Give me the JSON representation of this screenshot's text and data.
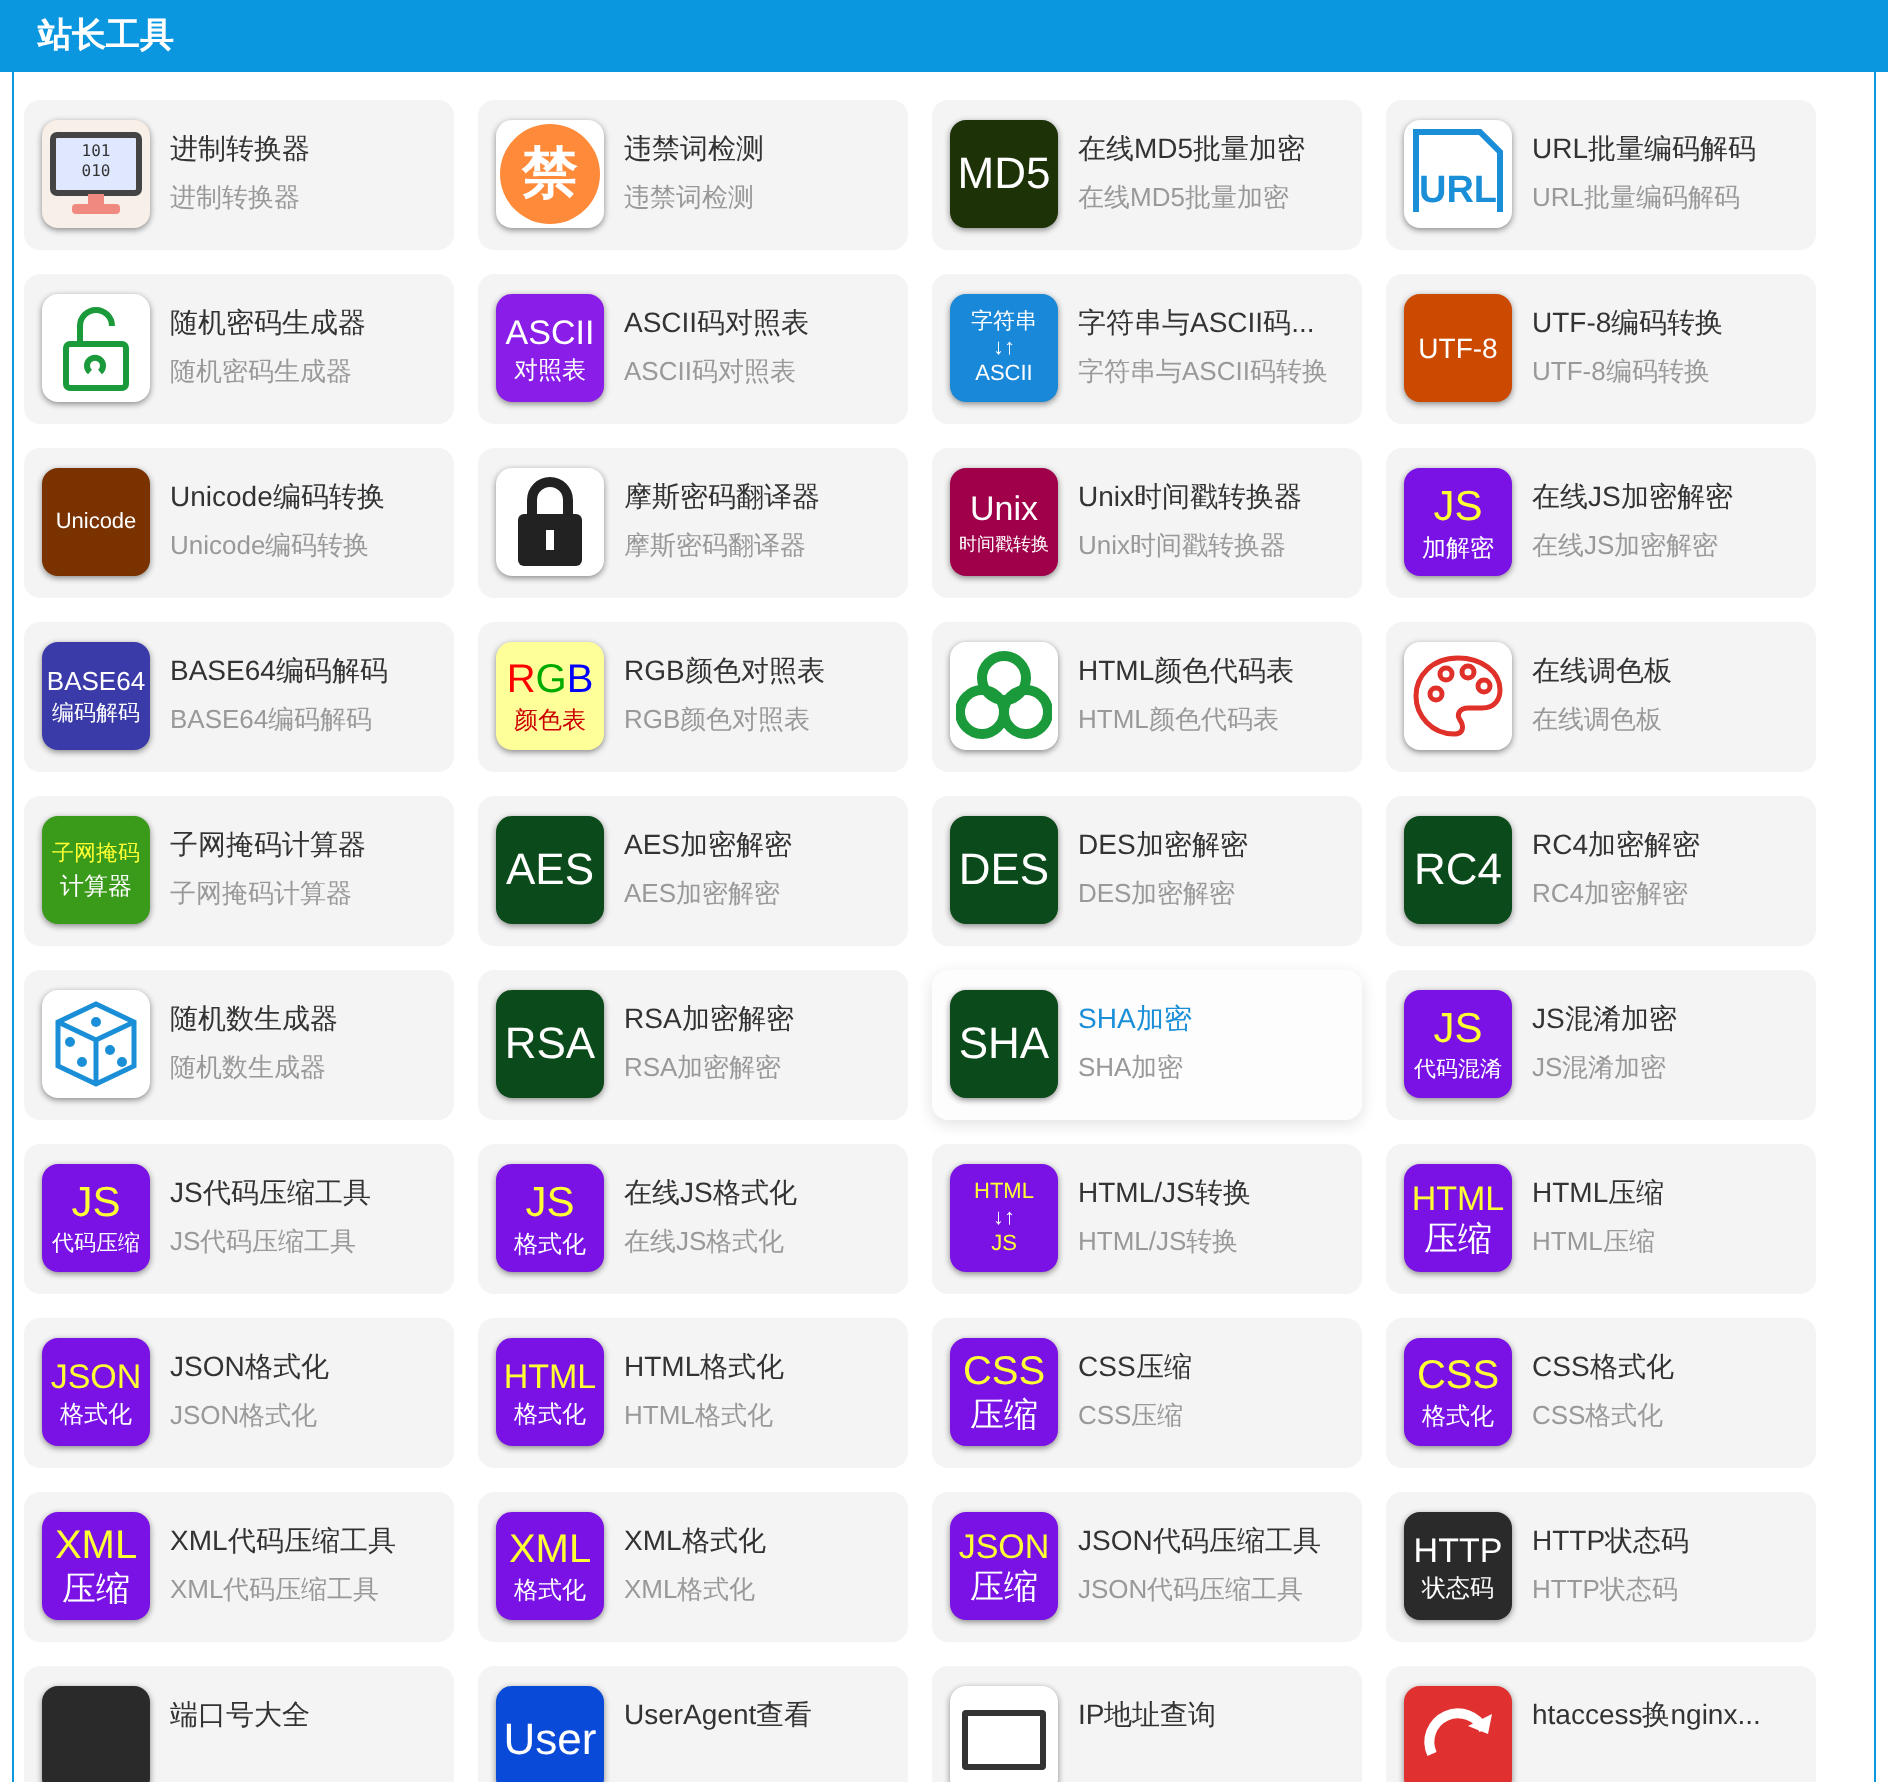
{
  "header": {
    "title": "站长工具"
  },
  "tools": [
    {
      "title": "进制转换器",
      "subtitle": "进制转换器",
      "hovered": false,
      "icon": {
        "kind": "monitor",
        "lines": [
          {
            "parts": [
              {
                "text": "101",
                "color": "#333333"
              }
            ]
          },
          {
            "parts": [
              {
                "text": "010",
                "color": "#333333"
              }
            ]
          }
        ]
      }
    },
    {
      "title": "违禁词检测",
      "subtitle": "违禁词检测",
      "hovered": false,
      "icon": {
        "kind": "circle",
        "color": "#ff8a3a",
        "lines": [
          {
            "parts": [
              {
                "text": "禁",
                "color": "#ffffff"
              }
            ]
          }
        ]
      }
    },
    {
      "title": "在线MD5批量加密",
      "subtitle": "在线MD5批量加密",
      "hovered": false,
      "icon": {
        "kind": "text",
        "color": "#1d3206",
        "lines": [
          {
            "parts": [
              {
                "text": "MD5",
                "color": "#ffffff"
              }
            ]
          }
        ]
      }
    },
    {
      "title": "URL批量编码解码",
      "subtitle": "URL批量编码解码",
      "hovered": false,
      "icon": {
        "kind": "document",
        "lines": [
          {
            "parts": [
              {
                "text": "URL",
                "color": "#1a8fd8"
              }
            ]
          }
        ]
      }
    },
    {
      "title": "随机密码生成器",
      "subtitle": "随机密码生成器",
      "hovered": false,
      "icon": {
        "kind": "open-lock"
      }
    },
    {
      "title": "ASCII码对照表",
      "subtitle": "ASCII码对照表",
      "hovered": false,
      "icon": {
        "kind": "text",
        "color": "#8a1ee8",
        "lines": [
          {
            "parts": [
              {
                "text": "ASCII",
                "color": "#ffffff"
              }
            ]
          },
          {
            "parts": [
              {
                "text": "对照表",
                "color": "#ffffff"
              }
            ]
          }
        ]
      }
    },
    {
      "title": "字符串与ASCII码...",
      "subtitle": "字符串与ASCII码转换",
      "hovered": false,
      "icon": {
        "kind": "text",
        "color": "#1a88d8",
        "lines": [
          {
            "parts": [
              {
                "text": "字符串",
                "color": "#ffffff"
              }
            ]
          },
          {
            "parts": [
              {
                "text": "↓↑",
                "color": "#ffffff"
              }
            ]
          },
          {
            "parts": [
              {
                "text": "ASCII",
                "color": "#ffffff"
              }
            ]
          }
        ]
      }
    },
    {
      "title": "UTF-8编码转换",
      "subtitle": "UTF-8编码转换",
      "hovered": false,
      "icon": {
        "kind": "text",
        "color": "#cc4a00",
        "lines": [
          {
            "parts": [
              {
                "text": "UTF-8",
                "color": "#ffffff"
              }
            ]
          }
        ]
      }
    },
    {
      "title": "Unicode编码转换",
      "subtitle": "Unicode编码转换",
      "hovered": false,
      "icon": {
        "kind": "text",
        "color": "#7a3200",
        "lines": [
          {
            "parts": [
              {
                "text": "Unicode",
                "color": "#ffffff"
              }
            ]
          }
        ]
      }
    },
    {
      "title": "摩斯密码翻译器",
      "subtitle": "摩斯密码翻译器",
      "hovered": false,
      "icon": {
        "kind": "padlock"
      }
    },
    {
      "title": "Unix时间戳转换器",
      "subtitle": "Unix时间戳转换器",
      "hovered": false,
      "icon": {
        "kind": "text",
        "color": "#a0004a",
        "lines": [
          {
            "parts": [
              {
                "text": "Unix",
                "color": "#ffffff"
              }
            ]
          },
          {
            "parts": [
              {
                "text": "时间戳转换",
                "color": "#ffffff"
              }
            ]
          }
        ]
      }
    },
    {
      "title": "在线JS加密解密",
      "subtitle": "在线JS加密解密",
      "hovered": false,
      "icon": {
        "kind": "text",
        "color": "#7a12e6",
        "lines": [
          {
            "parts": [
              {
                "text": "JS",
                "color": "#ffff33"
              }
            ]
          },
          {
            "parts": [
              {
                "text": "加解密",
                "color": "#ffffff"
              }
            ]
          }
        ]
      }
    },
    {
      "title": "BASE64编码解码",
      "subtitle": "BASE64编码解码",
      "hovered": false,
      "icon": {
        "kind": "text",
        "color": "#3a3aa8",
        "lines": [
          {
            "parts": [
              {
                "text": "BASE64",
                "color": "#ffffff"
              }
            ]
          },
          {
            "parts": [
              {
                "text": "编码解码",
                "color": "#ffffff"
              }
            ]
          }
        ]
      }
    },
    {
      "title": "RGB颜色对照表",
      "subtitle": "RGB颜色对照表",
      "hovered": false,
      "icon": {
        "kind": "text",
        "color": "#ffff99",
        "lines": [
          {
            "parts": [
              {
                "text": "R",
                "color": "#ff0000"
              },
              {
                "text": "G",
                "color": "#00aa00"
              },
              {
                "text": "B",
                "color": "#0000ff"
              }
            ]
          },
          {
            "parts": [
              {
                "text": "颜色表",
                "color": "#cc0000"
              }
            ]
          }
        ]
      }
    },
    {
      "title": "HTML颜色代码表",
      "subtitle": "HTML颜色代码表",
      "hovered": false,
      "icon": {
        "kind": "rings"
      }
    },
    {
      "title": "在线调色板",
      "subtitle": "在线调色板",
      "hovered": false,
      "icon": {
        "kind": "palette"
      }
    },
    {
      "title": "子网掩码计算器",
      "subtitle": "子网掩码计算器",
      "hovered": false,
      "icon": {
        "kind": "text",
        "color": "#3a9a1a",
        "lines": [
          {
            "parts": [
              {
                "text": "子网掩码",
                "color": "#ffff33"
              }
            ]
          },
          {
            "parts": [
              {
                "text": "计算器",
                "color": "#ffffff"
              }
            ]
          }
        ]
      }
    },
    {
      "title": "AES加密解密",
      "subtitle": "AES加密解密",
      "hovered": false,
      "icon": {
        "kind": "text",
        "color": "#0b4a1a",
        "lines": [
          {
            "parts": [
              {
                "text": "AES",
                "color": "#ffffff"
              }
            ]
          }
        ]
      }
    },
    {
      "title": "DES加密解密",
      "subtitle": "DES加密解密",
      "hovered": false,
      "icon": {
        "kind": "text",
        "color": "#0b4a1a",
        "lines": [
          {
            "parts": [
              {
                "text": "DES",
                "color": "#ffffff"
              }
            ]
          }
        ]
      }
    },
    {
      "title": "RC4加密解密",
      "subtitle": "RC4加密解密",
      "hovered": false,
      "icon": {
        "kind": "text",
        "color": "#0b4a1a",
        "lines": [
          {
            "parts": [
              {
                "text": "RC4",
                "color": "#ffffff"
              }
            ]
          }
        ]
      }
    },
    {
      "title": "随机数生成器",
      "subtitle": "随机数生成器",
      "hovered": false,
      "icon": {
        "kind": "dice"
      }
    },
    {
      "title": "RSA加密解密",
      "subtitle": "RSA加密解密",
      "hovered": false,
      "icon": {
        "kind": "text",
        "color": "#0b4a1a",
        "lines": [
          {
            "parts": [
              {
                "text": "RSA",
                "color": "#ffffff"
              }
            ]
          }
        ]
      }
    },
    {
      "title": "SHA加密",
      "subtitle": "SHA加密",
      "hovered": true,
      "icon": {
        "kind": "text",
        "color": "#0b4a1a",
        "lines": [
          {
            "parts": [
              {
                "text": "SHA",
                "color": "#ffffff"
              }
            ]
          }
        ]
      }
    },
    {
      "title": "JS混淆加密",
      "subtitle": "JS混淆加密",
      "hovered": false,
      "icon": {
        "kind": "text",
        "color": "#7a12e6",
        "lines": [
          {
            "parts": [
              {
                "text": "JS",
                "color": "#ffff33"
              }
            ]
          },
          {
            "parts": [
              {
                "text": "代码混淆",
                "color": "#ffffff"
              }
            ]
          }
        ]
      }
    },
    {
      "title": "JS代码压缩工具",
      "subtitle": "JS代码压缩工具",
      "hovered": false,
      "icon": {
        "kind": "text",
        "color": "#7a12e6",
        "lines": [
          {
            "parts": [
              {
                "text": "JS",
                "color": "#ffff33"
              }
            ]
          },
          {
            "parts": [
              {
                "text": "代码压缩",
                "color": "#ffffff"
              }
            ]
          }
        ]
      }
    },
    {
      "title": "在线JS格式化",
      "subtitle": "在线JS格式化",
      "hovered": false,
      "icon": {
        "kind": "text",
        "color": "#7a12e6",
        "lines": [
          {
            "parts": [
              {
                "text": "JS",
                "color": "#ffff33"
              }
            ]
          },
          {
            "parts": [
              {
                "text": "格式化",
                "color": "#ffffff"
              }
            ]
          }
        ]
      }
    },
    {
      "title": "HTML/JS转换",
      "subtitle": "HTML/JS转换",
      "hovered": false,
      "icon": {
        "kind": "text",
        "color": "#7a12e6",
        "lines": [
          {
            "parts": [
              {
                "text": "HTML",
                "color": "#ffff33"
              }
            ]
          },
          {
            "parts": [
              {
                "text": "↓↑",
                "color": "#ffffff"
              }
            ]
          },
          {
            "parts": [
              {
                "text": "JS",
                "color": "#ffff33"
              }
            ]
          }
        ]
      }
    },
    {
      "title": "HTML压缩",
      "subtitle": "HTML压缩",
      "hovered": false,
      "icon": {
        "kind": "text",
        "color": "#7a12e6",
        "lines": [
          {
            "parts": [
              {
                "text": "HTML",
                "color": "#ffff33"
              }
            ]
          },
          {
            "parts": [
              {
                "text": "压缩",
                "color": "#ffffff"
              }
            ]
          }
        ]
      }
    },
    {
      "title": "JSON格式化",
      "subtitle": "JSON格式化",
      "hovered": false,
      "icon": {
        "kind": "text",
        "color": "#7a12e6",
        "lines": [
          {
            "parts": [
              {
                "text": "JSON",
                "color": "#ffff33"
              }
            ]
          },
          {
            "parts": [
              {
                "text": "格式化",
                "color": "#ffffff"
              }
            ]
          }
        ]
      }
    },
    {
      "title": "HTML格式化",
      "subtitle": "HTML格式化",
      "hovered": false,
      "icon": {
        "kind": "text",
        "color": "#7a12e6",
        "lines": [
          {
            "parts": [
              {
                "text": "HTML",
                "color": "#ffff33"
              }
            ]
          },
          {
            "parts": [
              {
                "text": "格式化",
                "color": "#ffffff"
              }
            ]
          }
        ]
      }
    },
    {
      "title": "CSS压缩",
      "subtitle": "CSS压缩",
      "hovered": false,
      "icon": {
        "kind": "text",
        "color": "#7a12e6",
        "lines": [
          {
            "parts": [
              {
                "text": "CSS",
                "color": "#ffff33"
              }
            ]
          },
          {
            "parts": [
              {
                "text": "压缩",
                "color": "#ffffff"
              }
            ]
          }
        ]
      }
    },
    {
      "title": "CSS格式化",
      "subtitle": "CSS格式化",
      "hovered": false,
      "icon": {
        "kind": "text",
        "color": "#7a12e6",
        "lines": [
          {
            "parts": [
              {
                "text": "CSS",
                "color": "#ffff33"
              }
            ]
          },
          {
            "parts": [
              {
                "text": "格式化",
                "color": "#ffffff"
              }
            ]
          }
        ]
      }
    },
    {
      "title": "XML代码压缩工具",
      "subtitle": "XML代码压缩工具",
      "hovered": false,
      "icon": {
        "kind": "text",
        "color": "#7a12e6",
        "lines": [
          {
            "parts": [
              {
                "text": "XML",
                "color": "#ffff33"
              }
            ]
          },
          {
            "parts": [
              {
                "text": "压缩",
                "color": "#ffffff"
              }
            ]
          }
        ]
      }
    },
    {
      "title": "XML格式化",
      "subtitle": "XML格式化",
      "hovered": false,
      "icon": {
        "kind": "text",
        "color": "#7a12e6",
        "lines": [
          {
            "parts": [
              {
                "text": "XML",
                "color": "#ffff33"
              }
            ]
          },
          {
            "parts": [
              {
                "text": "格式化",
                "color": "#ffffff"
              }
            ]
          }
        ]
      }
    },
    {
      "title": "JSON代码压缩工具",
      "subtitle": "JSON代码压缩工具",
      "hovered": false,
      "icon": {
        "kind": "text",
        "color": "#7a12e6",
        "lines": [
          {
            "parts": [
              {
                "text": "JSON",
                "color": "#ffff33"
              }
            ]
          },
          {
            "parts": [
              {
                "text": "压缩",
                "color": "#ffffff"
              }
            ]
          }
        ]
      }
    },
    {
      "title": "HTTP状态码",
      "subtitle": "HTTP状态码",
      "hovered": false,
      "icon": {
        "kind": "text",
        "color": "#2a2a2a",
        "lines": [
          {
            "parts": [
              {
                "text": "HTTP",
                "color": "#ffffff"
              }
            ]
          },
          {
            "parts": [
              {
                "text": "状态码",
                "color": "#ffffff"
              }
            ]
          }
        ]
      }
    },
    {
      "title": "端口号大全",
      "hovered": false,
      "icon": {
        "kind": "text",
        "color": "#2a2a2a"
      }
    },
    {
      "title": "UserAgent查看",
      "hovered": false,
      "icon": {
        "kind": "text",
        "color": "#0a4ad8",
        "lines": [
          {
            "parts": [
              {
                "text": "User",
                "color": "#ffffff"
              }
            ]
          }
        ]
      }
    },
    {
      "title": "IP地址查询",
      "hovered": false,
      "icon": {
        "kind": "screen"
      }
    },
    {
      "title": "htaccess换nginx...",
      "hovered": false,
      "icon": {
        "kind": "redo",
        "color": "#e03030"
      }
    }
  ]
}
